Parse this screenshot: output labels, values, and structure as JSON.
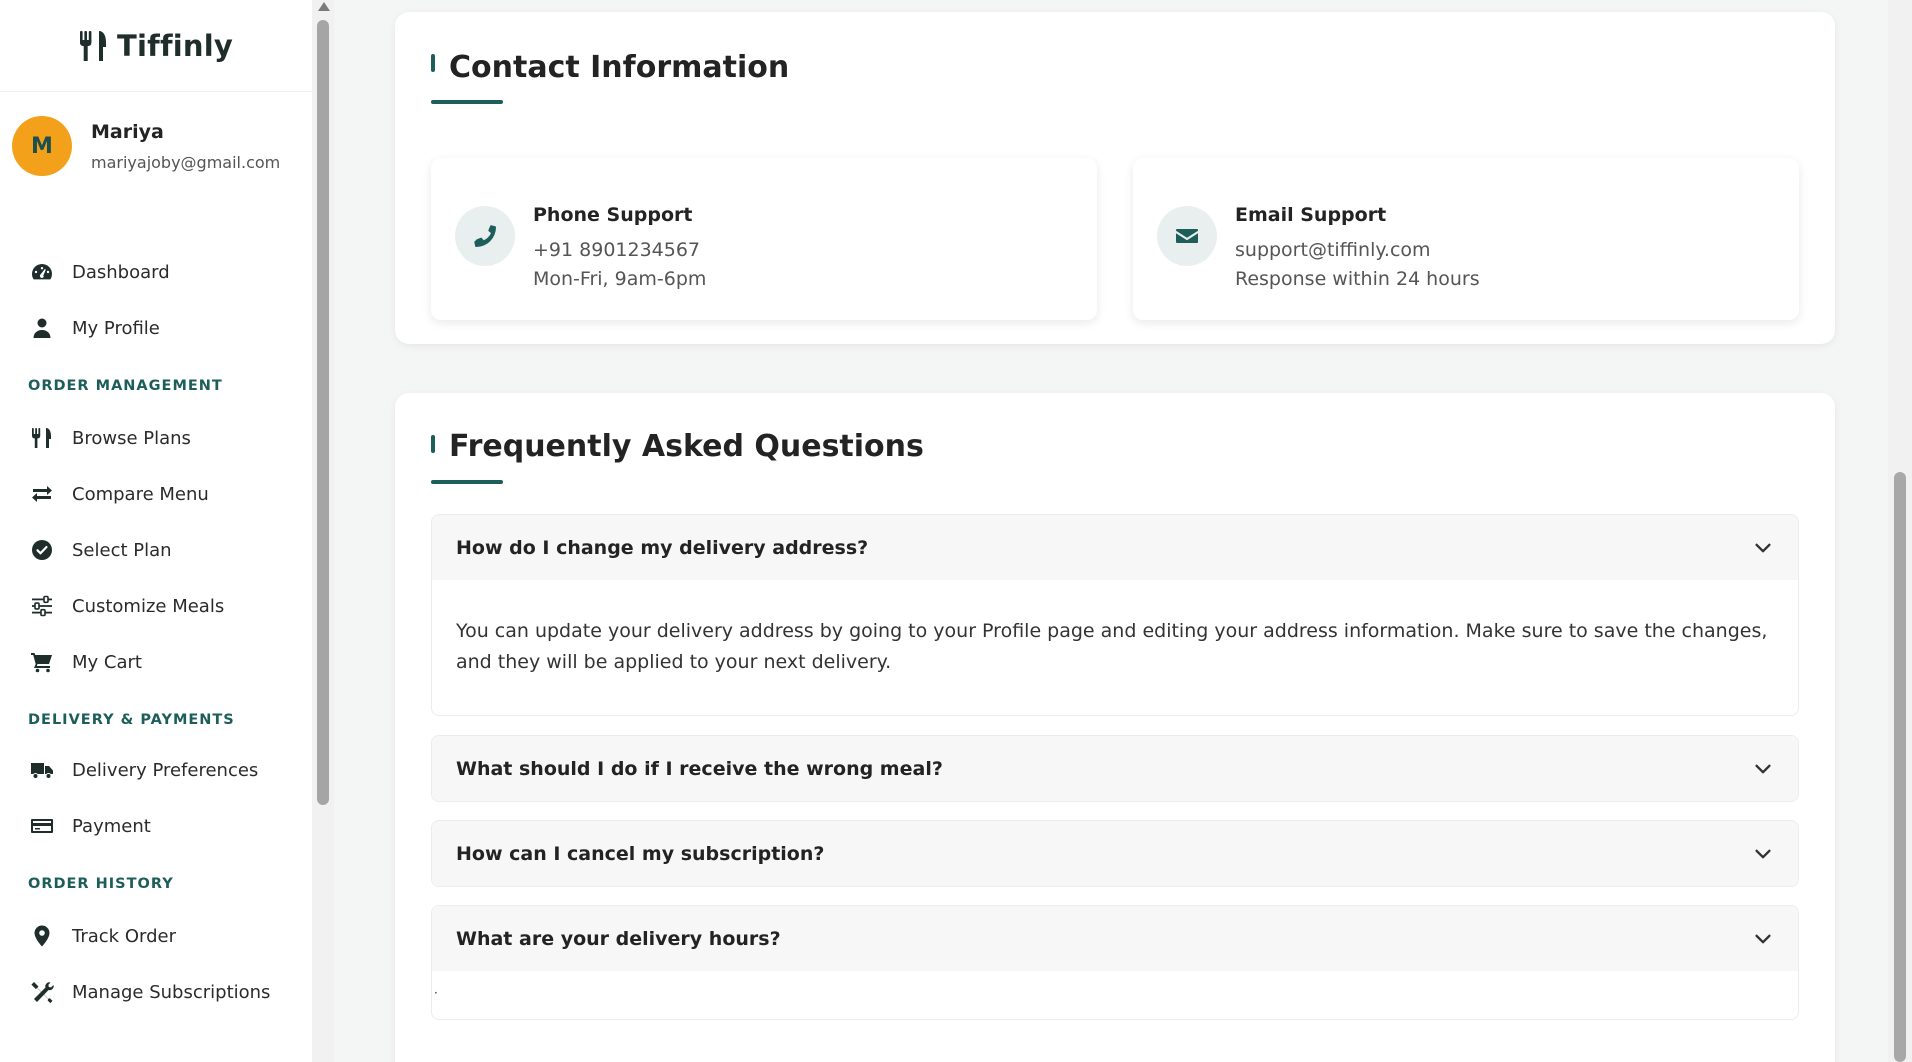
{
  "brand": {
    "name": "Tiffinly",
    "icon": "utensils-icon"
  },
  "user": {
    "initial": "M",
    "name": "Mariya",
    "email": "mariyajoby@gmail.com"
  },
  "nav": {
    "dashboard": "Dashboard",
    "my_profile": "My Profile",
    "order_management": "ORDER MANAGEMENT",
    "browse_plans": "Browse Plans",
    "compare_menu": "Compare Menu",
    "select_plan": "Select Plan",
    "customize_meals": "Customize Meals",
    "my_cart": "My Cart",
    "delivery_payments": "DELIVERY & PAYMENTS",
    "delivery_preferences": "Delivery Preferences",
    "payment": "Payment",
    "order_history": "ORDER HISTORY",
    "track_order": "Track Order",
    "manage_subscriptions": "Manage Subscriptions"
  },
  "contact": {
    "title": "Contact Information",
    "phone": {
      "title": "Phone Support",
      "line1": "+91 8901234567",
      "line2": "Mon-Fri, 9am-6pm"
    },
    "email": {
      "title": "Email Support",
      "line1": "support@tiffinly.com",
      "line2": "Response within 24 hours"
    }
  },
  "faq": {
    "title": "Frequently Asked Questions",
    "items": [
      {
        "question": "How do I change my delivery address?",
        "answer": "You can update your delivery address by going to your Profile page and editing your address information. Make sure to save the changes, and they will be applied to your next delivery.",
        "expanded": true
      },
      {
        "question": "What should I do if I receive the wrong meal?",
        "expanded": false
      },
      {
        "question": "How can I cancel my subscription?",
        "expanded": false
      },
      {
        "question": "What are your delivery hours?",
        "expanded": true
      }
    ]
  },
  "colors": {
    "accent": "#1d5e5b",
    "avatar": "#f3a11b",
    "background": "#f4f5f5"
  }
}
